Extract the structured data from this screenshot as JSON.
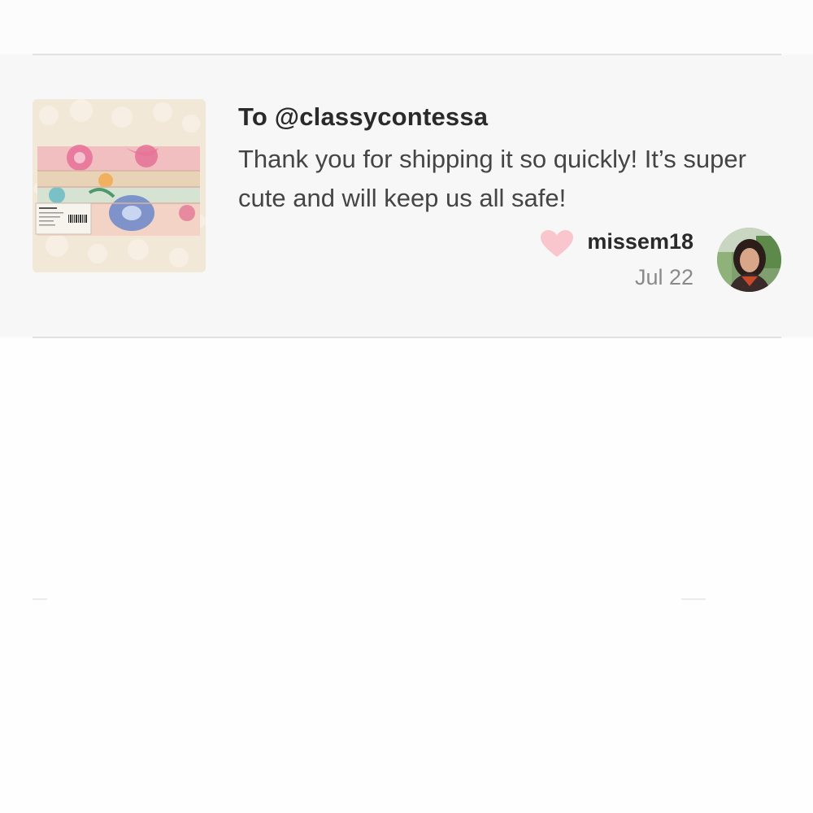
{
  "review": {
    "recipient": "To @classycontessa",
    "message": "Thank you for shipping it so quickly! It’s super cute and will keep us all safe!",
    "username": "missem18",
    "date": "Jul 22",
    "heart_color": "#f8c6cc"
  },
  "icons": {
    "heart": "heart-icon",
    "avatar": "user-avatar",
    "product": "product-photo"
  }
}
